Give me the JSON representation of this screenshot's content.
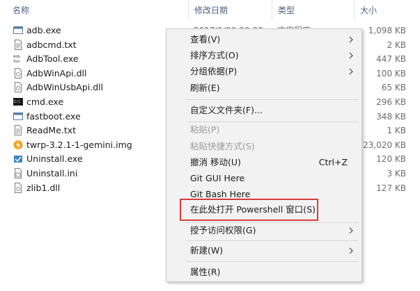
{
  "columns": {
    "name": "名称",
    "date": "修改日期",
    "type": "类型",
    "size": "大小"
  },
  "files": [
    {
      "name": "adb.exe",
      "date": "2017/1/29 20:20",
      "type": "应用程序",
      "size": "1,098 KB",
      "icon": "exe-window-icon"
    },
    {
      "name": "adbcmd.txt",
      "date": "",
      "type": "",
      "size": "2 KB",
      "icon": "text-file-icon"
    },
    {
      "name": "AdbTool.exe",
      "date": "",
      "type": "",
      "size": "447 KB",
      "icon": "adbtool-app-icon"
    },
    {
      "name": "AdbWinApi.dll",
      "date": "",
      "type": "",
      "size": "100 KB",
      "icon": "dll-file-icon"
    },
    {
      "name": "AdbWinUsbApi.dll",
      "date": "",
      "type": "",
      "size": "65 KB",
      "icon": "dll-file-icon"
    },
    {
      "name": "cmd.exe",
      "date": "",
      "type": "",
      "size": "296 KB",
      "icon": "console-icon"
    },
    {
      "name": "fastboot.exe",
      "date": "",
      "type": "",
      "size": "348 KB",
      "icon": "exe-window-icon"
    },
    {
      "name": "ReadMe.txt",
      "date": "",
      "type": "",
      "size": "1 KB",
      "icon": "text-file-icon"
    },
    {
      "name": "twrp-3.2.1-1-gemini.img",
      "date": "",
      "type": "",
      "size": "23,020 KB",
      "icon": "lightning-icon"
    },
    {
      "name": "Uninstall.exe",
      "date": "",
      "type": "",
      "size": "120 KB",
      "icon": "installer-icon"
    },
    {
      "name": "Uninstall.ini",
      "date": "",
      "type": "",
      "size": "3 KB",
      "icon": "ini-file-icon"
    },
    {
      "name": "zlib1.dll",
      "date": "",
      "type": "",
      "size": "127 KB",
      "icon": "dll-file-icon"
    }
  ],
  "menu": {
    "view": "查看(V)",
    "sort": "排序方式(O)",
    "group": "分组依据(P)",
    "refresh": "刷新(E)",
    "customize": "自定义文件夹(F)...",
    "paste": "粘贴(P)",
    "paste_shortcut": "粘贴快捷方式(S)",
    "undo_move": "撤消 移动(U)",
    "undo_shortcut": "Ctrl+Z",
    "git_gui": "Git GUI Here",
    "git_bash": "Git Bash Here",
    "powershell": "在此处打开 Powershell 窗口(S)",
    "give_access": "授予访问权限(G)",
    "new": "新建(W)",
    "properties": "属性(R)"
  },
  "colors": {
    "highlight_border": "#d93b3b",
    "menu_background": "#f2f2f2",
    "header_text": "#4d6082"
  }
}
